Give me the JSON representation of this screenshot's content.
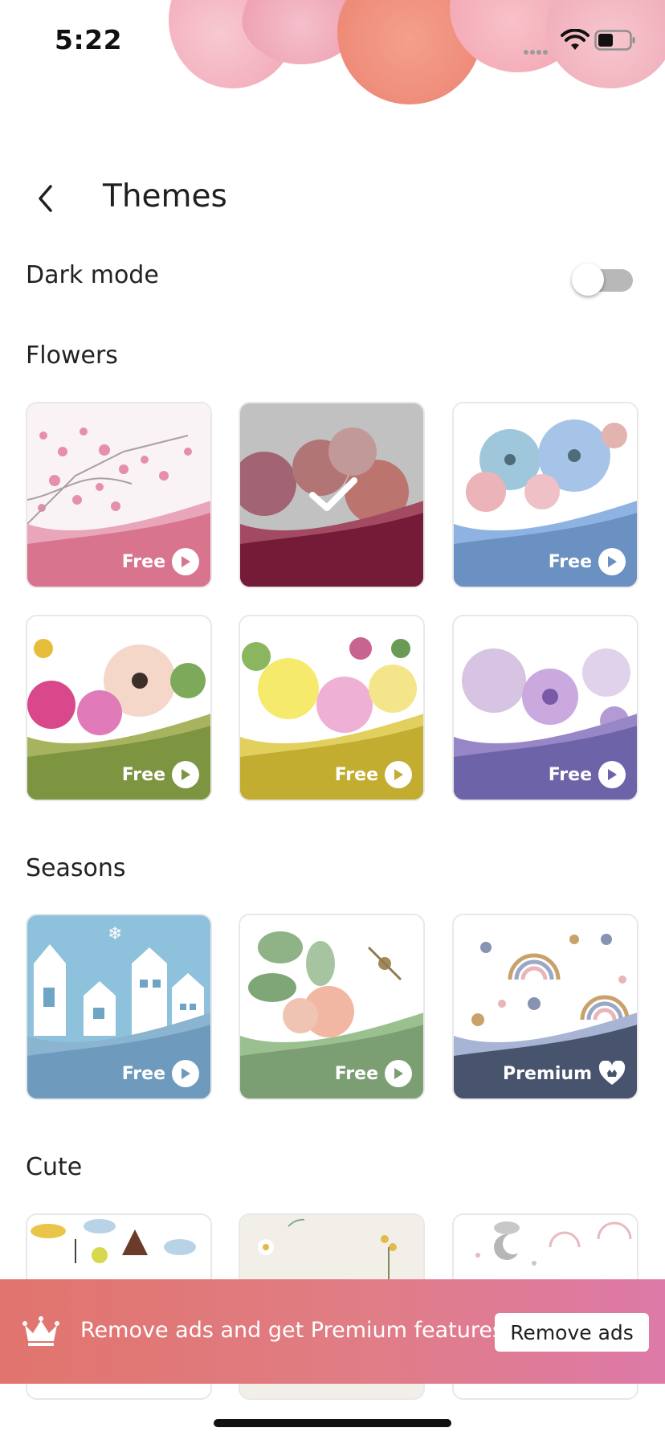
{
  "status_bar": {
    "time": "5:22"
  },
  "header": {
    "title": "Themes",
    "back_icon": "chevron-left-icon"
  },
  "dark_mode": {
    "label": "Dark mode",
    "enabled": false
  },
  "sections": [
    {
      "title": "Flowers",
      "themes": [
        {
          "name": "Cherry blossom",
          "badge": "Free",
          "badge_icon": "play-icon",
          "selected": false,
          "colors": [
            "#f7e7ee",
            "#e38aa4",
            "#d9748f"
          ]
        },
        {
          "name": "Red poppies",
          "badge": "",
          "badge_icon": "check-icon",
          "selected": true,
          "colors": [
            "#c9c9c9",
            "#a33850",
            "#731b37"
          ]
        },
        {
          "name": "Blue watercolor",
          "badge": "Free",
          "badge_icon": "play-icon",
          "selected": false,
          "colors": [
            "#ffffff",
            "#8eb3e3",
            "#6b90c2"
          ]
        },
        {
          "name": "Pink bouquet",
          "badge": "Free",
          "badge_icon": "play-icon",
          "selected": false,
          "colors": [
            "#ffffff",
            "#a8b360",
            "#7d9440"
          ]
        },
        {
          "name": "Yellow bouquet",
          "badge": "Free",
          "badge_icon": "play-icon",
          "selected": false,
          "colors": [
            "#ffffff",
            "#e1cf5e",
            "#c2ad31"
          ]
        },
        {
          "name": "Purple bouquet",
          "badge": "Free",
          "badge_icon": "play-icon",
          "selected": false,
          "colors": [
            "#ffffff",
            "#9787c7",
            "#6d63a8"
          ]
        }
      ]
    },
    {
      "title": "Seasons",
      "themes": [
        {
          "name": "Winter village",
          "badge": "Free",
          "badge_icon": "play-icon",
          "selected": false,
          "colors": [
            "#8ec2dc",
            "#8ab4d0",
            "#6e9bbd"
          ]
        },
        {
          "name": "Spring leaves",
          "badge": "Free",
          "badge_icon": "play-icon",
          "selected": false,
          "colors": [
            "#ffffff",
            "#9bc08f",
            "#7b9e72"
          ]
        },
        {
          "name": "Rainbows",
          "badge": "Premium",
          "badge_icon": "heart-icon",
          "selected": false,
          "colors": [
            "#ffffff",
            "#a7b4d3",
            "#48546e"
          ]
        }
      ]
    },
    {
      "title": "Cute",
      "themes": [
        {
          "name": "Dinosaurs",
          "colors": [
            "#ffffff"
          ]
        },
        {
          "name": "Botanical",
          "colors": [
            "#f1efe8"
          ]
        },
        {
          "name": "Moon and stars",
          "colors": [
            "#ffffff"
          ]
        }
      ]
    }
  ],
  "promo": {
    "text": "Remove ads and get Premium features",
    "button_label": "Remove ads",
    "icon": "crown-icon"
  }
}
